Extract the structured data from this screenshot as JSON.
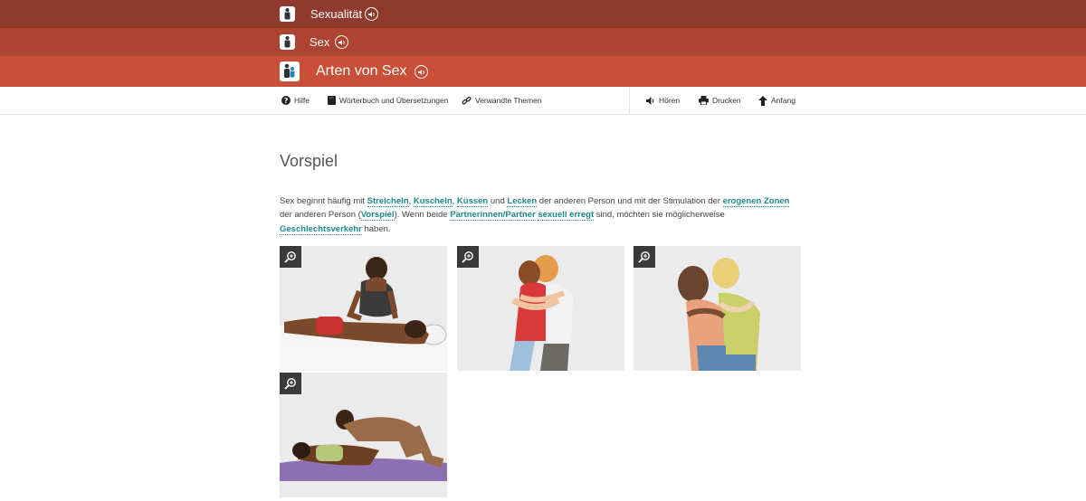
{
  "breadcrumbs": [
    {
      "label": "Sexualität"
    },
    {
      "label": "Sex"
    },
    {
      "label": "Arten von Sex"
    }
  ],
  "toolbar": {
    "help": "Hilfe",
    "dictionary": "Wörterbuch und Übersetzungen",
    "related": "Verwandte Themen",
    "listen": "Hören",
    "print": "Drucken",
    "top": "Anfang"
  },
  "section": {
    "title": "Vorspiel",
    "text": [
      {
        "t": "Sex beginnt häufig mit "
      },
      {
        "link": "Streicheln"
      },
      {
        "t": ", "
      },
      {
        "link": "Kuscheln"
      },
      {
        "t": ", "
      },
      {
        "link": "Küssen"
      },
      {
        "t": " und "
      },
      {
        "link": "Lecken"
      },
      {
        "t": " der anderen Person und mit der Stimulation der "
      },
      {
        "link": "erogenen Zonen"
      },
      {
        "t": " der anderen Person ("
      },
      {
        "link": "Vorspiel"
      },
      {
        "t": "). Wenn beide "
      },
      {
        "link": "Partnerinnen/Partner"
      },
      {
        "t": " "
      },
      {
        "link": "sexuell erregt"
      },
      {
        "t": " sind, möchten sie möglicherweise "
      },
      {
        "link": "Geschlechtsverkehr"
      },
      {
        "t": " haben."
      }
    ]
  },
  "colors": {
    "crumb1": "#8f3a2c",
    "crumb2": "#ad4331",
    "crumb3": "#c94f38",
    "link": "#1f8a8c"
  },
  "images": [
    {
      "icon": "zoom-icon"
    },
    {
      "icon": "zoom-icon"
    },
    {
      "icon": "zoom-icon"
    },
    {
      "icon": "zoom-icon"
    }
  ]
}
